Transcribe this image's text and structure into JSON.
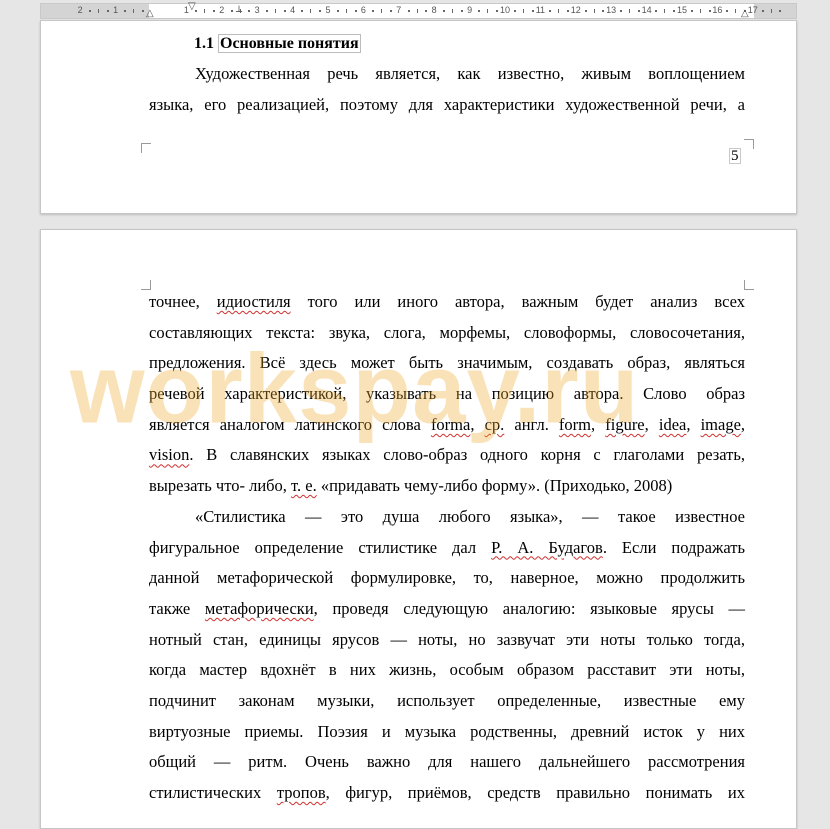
{
  "ruler": {
    "numbers": [
      "2",
      "1",
      "1",
      "2",
      "3",
      "4",
      "5",
      "6",
      "7",
      "8",
      "9",
      "10",
      "11",
      "12",
      "13",
      "14",
      "15",
      "16",
      "17"
    ]
  },
  "page1": {
    "heading_number": "1.1",
    "heading_title": "Основные понятия",
    "lines": [
      "Художественная речь является, как известно, живым воплощением",
      "языка, его реализацией, поэтому для характеристики художественной речи, а"
    ],
    "page_number": "5"
  },
  "page2": {
    "lines": [
      {
        "parts": [
          {
            "t": "точнее, "
          },
          {
            "t": "идиостиля",
            "sq": true
          },
          {
            "t": " того или иного автора, важным будет анализ всех"
          }
        ]
      },
      {
        "parts": [
          {
            "t": "составляющих текста: звука, слога, морфемы, словоформы, словосочетания,"
          }
        ]
      },
      {
        "parts": [
          {
            "t": "предложения. Всё здесь может быть значимым, создавать образ, являться"
          }
        ]
      },
      {
        "parts": [
          {
            "t": "речевой характеристикой, указывать на позицию автора. Слово образ"
          }
        ]
      },
      {
        "parts": [
          {
            "t": "является аналогом латинского слова "
          },
          {
            "t": "forma",
            "sq": true
          },
          {
            "t": ", "
          },
          {
            "t": "ср.",
            "sq": true
          },
          {
            "t": " англ. "
          },
          {
            "t": "form",
            "sq": true
          },
          {
            "t": ", "
          },
          {
            "t": "figure",
            "sq": true
          },
          {
            "t": ", "
          },
          {
            "t": "idea",
            "sq": true
          },
          {
            "t": ", "
          },
          {
            "t": "image",
            "sq": true
          },
          {
            "t": ","
          }
        ]
      },
      {
        "parts": [
          {
            "t": "vision",
            "sq": true
          },
          {
            "t": ". В славянских языках слово-образ одного корня с глаголами резать,"
          }
        ]
      },
      {
        "parts": [
          {
            "t": "вырезать что- либо, "
          },
          {
            "t": "т. е.",
            "sq": true
          },
          {
            "t": " «придавать чему-либо форму». (Приходько, 2008)"
          }
        ],
        "last": true
      },
      {
        "parts": [
          {
            "t": "«Стилистика — это душа любого языка», — такое известное"
          }
        ],
        "indent": true
      },
      {
        "parts": [
          {
            "t": "фигуральное определение стилистике дал "
          },
          {
            "t": "Р. А. Будагов",
            "sq": true
          },
          {
            "t": ". Если подражать"
          }
        ]
      },
      {
        "parts": [
          {
            "t": "данной метафорической формулировке, то, наверное, можно продолжить"
          }
        ]
      },
      {
        "parts": [
          {
            "t": "также "
          },
          {
            "t": "метафорически",
            "sq": true
          },
          {
            "t": ", проведя следующую аналогию: языковые ярусы —"
          }
        ]
      },
      {
        "parts": [
          {
            "t": "нотный стан, единицы ярусов — ноты, но зазвучат эти ноты только тогда,"
          }
        ]
      },
      {
        "parts": [
          {
            "t": "когда мастер вдохнёт в них жизнь, особым образом расставит эти ноты,"
          }
        ]
      },
      {
        "parts": [
          {
            "t": "подчинит законам музыки, использует определенные, известные ему"
          }
        ]
      },
      {
        "parts": [
          {
            "t": "виртуозные приемы. Поэзия и музыка родственны, древний исток у них"
          }
        ]
      },
      {
        "parts": [
          {
            "t": "общий — ритм. Очень важно для нашего дальнейшего рассмотрения"
          }
        ]
      },
      {
        "parts": [
          {
            "t": "стилистических "
          },
          {
            "t": "тропов",
            "sq": true
          },
          {
            "t": ", фигур, приёмов, средств правильно понимать их"
          }
        ]
      }
    ]
  },
  "watermark": "workspay.ru",
  "colors": {
    "watermark": "#f0a828",
    "spell_underline": "#d03030"
  }
}
